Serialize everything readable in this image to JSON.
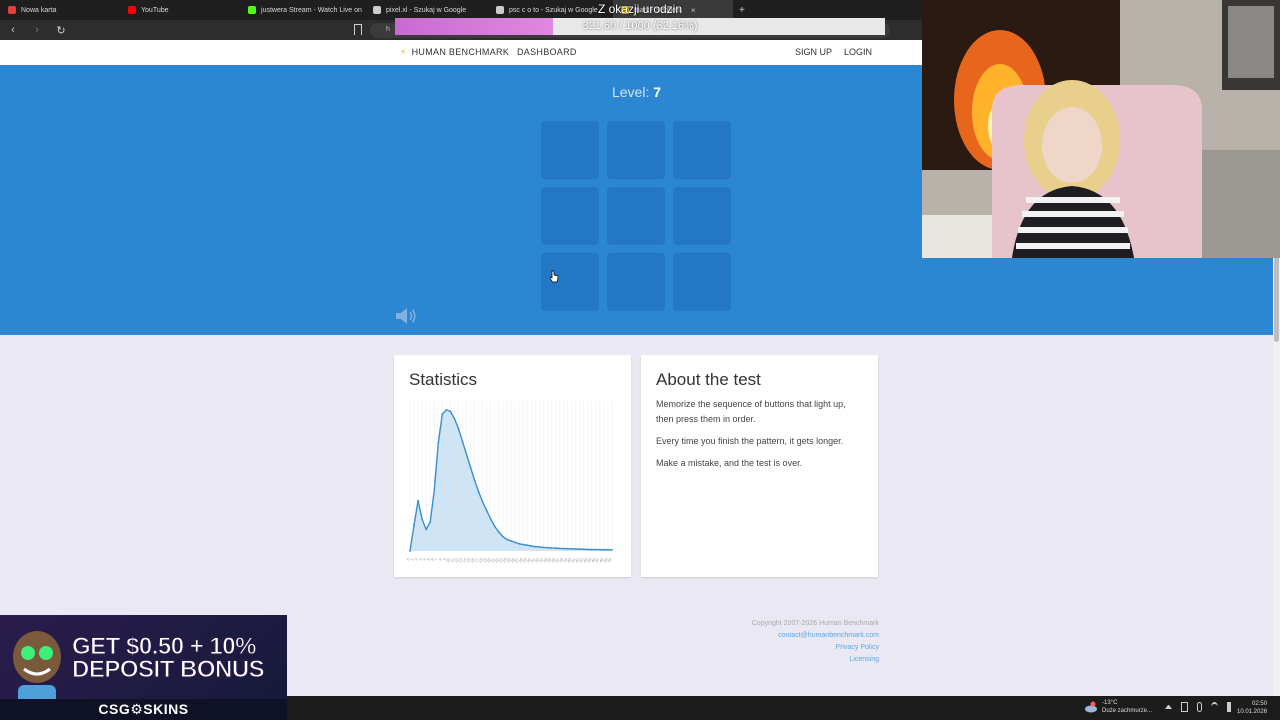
{
  "browser": {
    "tabs": [
      {
        "label": "Nowa karta",
        "color": "#e04040"
      },
      {
        "label": "YouTube",
        "color": "#ff0000"
      },
      {
        "label": "justwera Stream - Watch Live on",
        "color": "#53fc18"
      },
      {
        "label": "pixel.xl - Szukaj w Google",
        "color": "#cccccc"
      },
      {
        "label": "psc c o to - Szukaj w Google",
        "color": "#cccccc"
      },
      {
        "label": "mark - Sequen",
        "color": "#f0b400"
      }
    ],
    "address": "h"
  },
  "stream_goal": {
    "title": "Z okazji urodzin",
    "progress_text": "321.60 / 1000 (32.16%)",
    "progress_fraction": 0.3216
  },
  "site_nav": {
    "brand": "HUMAN BENCHMARK",
    "dashboard": "DASHBOARD",
    "sign_up": "SIGN UP",
    "login": "LOGIN"
  },
  "test": {
    "level_label": "Level:",
    "level_value": "7",
    "squares": 9,
    "colors": {
      "background": "#2b87d1",
      "square": "#2377c4"
    }
  },
  "stats": {
    "title": "Statistics",
    "chart_data": {
      "type": "area",
      "x": [
        0,
        1,
        2,
        3,
        4,
        5,
        6,
        7,
        8,
        9,
        10,
        11,
        12,
        13,
        14,
        15,
        16,
        17,
        18,
        19,
        20,
        21,
        22,
        23,
        24,
        25,
        26,
        27,
        28,
        29,
        30,
        31,
        32,
        33,
        34,
        35,
        36,
        37,
        38,
        39,
        40,
        41,
        42,
        43,
        44,
        45,
        46,
        47,
        48,
        49,
        50
      ],
      "values": [
        0,
        18,
        35,
        22,
        15,
        20,
        42,
        75,
        95,
        98,
        97,
        92,
        85,
        76,
        67,
        58,
        49,
        41,
        34,
        28,
        22,
        17,
        13,
        10,
        8,
        7,
        6,
        5,
        4.5,
        4,
        3.5,
        3,
        2.8,
        2.5,
        2.3,
        2.1,
        2,
        1.8,
        1.7,
        1.6,
        1.5,
        1.4,
        1.3,
        1.2,
        1.1,
        1.0,
        1.0,
        0.9,
        0.9,
        0.8,
        0.8
      ],
      "color": "#3a8fd0",
      "fill": "#cfe5f6"
    }
  },
  "about": {
    "title": "About the test",
    "paragraphs": [
      "Memorize the sequence of buttons that light up, then press them in order.",
      "Every time you finish the pattern, it gets longer.",
      "Make a mistake, and the test is over."
    ]
  },
  "footer": {
    "copyright": "Copyright 2007-2026 Human Benchmark",
    "email": "contact@humanbenchmark.com",
    "privacy": "Privacy Policy",
    "licensing": "Licensing"
  },
  "ad": {
    "line1": "GET $0.50 + 10%",
    "line2": "DEPOSIT BONUS",
    "brand": "CSG⚙SKINS"
  },
  "taskbar": {
    "temperature": "-13°C",
    "weather": "Duże zachmurze...",
    "time": "02:50",
    "date": "10.01.2026"
  }
}
